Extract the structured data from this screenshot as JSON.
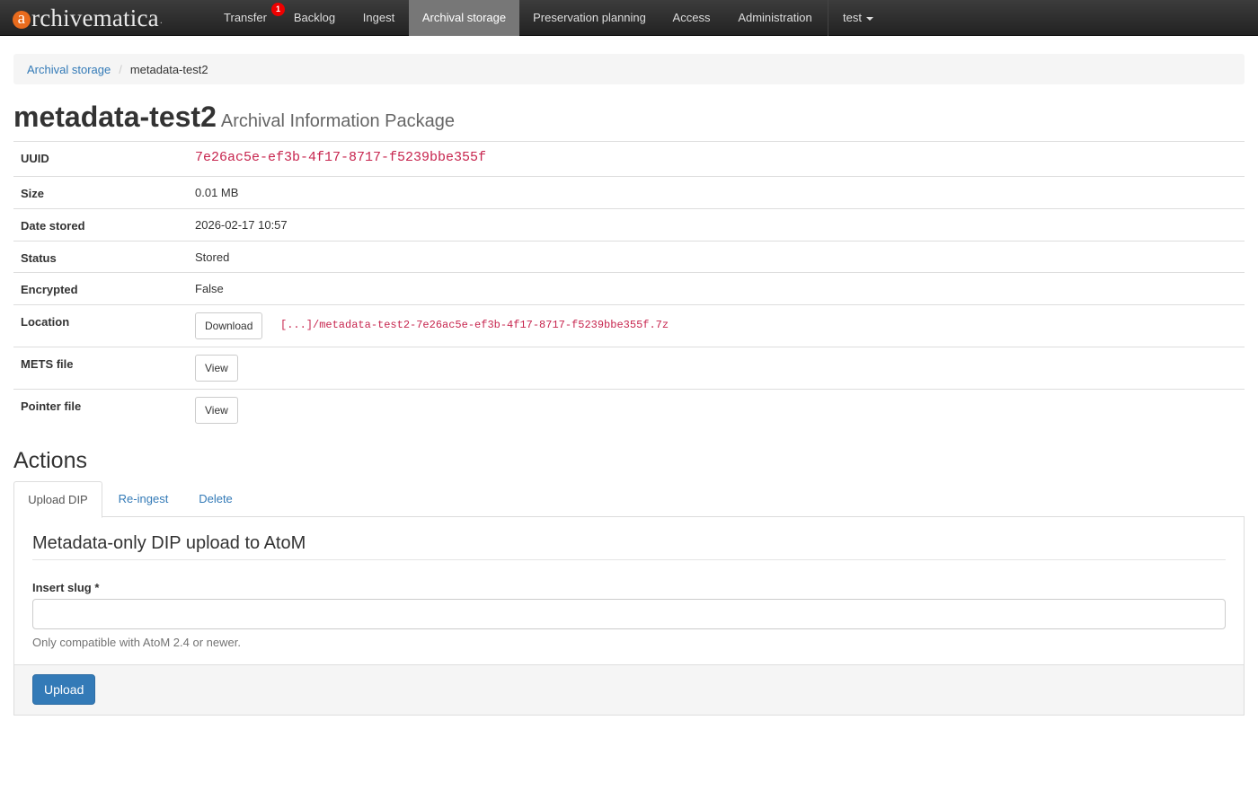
{
  "navbar": {
    "brand": {
      "mark": "a",
      "text": "rchivematica",
      "dot": "."
    },
    "items": [
      {
        "label": "Transfer",
        "badge": "1"
      },
      {
        "label": "Backlog"
      },
      {
        "label": "Ingest"
      },
      {
        "label": "Archival storage"
      },
      {
        "label": "Preservation planning"
      },
      {
        "label": "Access"
      },
      {
        "label": "Administration"
      }
    ],
    "active_item": "Archival storage",
    "user_menu": "test"
  },
  "breadcrumb": {
    "parent": "Archival storage",
    "current": "metadata-test2"
  },
  "page": {
    "title": "metadata-test2",
    "subtitle": "Archival Information Package"
  },
  "info": {
    "uuid_label": "UUID",
    "uuid": "7e26ac5e-ef3b-4f17-8717-f5239bbe355f",
    "size_label": "Size",
    "size": "0.01 MB",
    "date_label": "Date stored",
    "date": "2026-02-17 10:57",
    "status_label": "Status",
    "status": "Stored",
    "encrypted_label": "Encrypted",
    "encrypted": "False",
    "location_label": "Location",
    "download_label": "Download",
    "location_path": "[...]/metadata-test2-7e26ac5e-ef3b-4f17-8717-f5239bbe355f.7z",
    "mets_label": "METS file",
    "mets_view": "View",
    "pointer_label": "Pointer file",
    "pointer_view": "View"
  },
  "actions": {
    "title": "Actions",
    "tabs": [
      "Upload DIP",
      "Re-ingest",
      "Delete"
    ],
    "active_tab": "Upload DIP",
    "panel": {
      "heading": "Metadata-only DIP upload to AtoM",
      "field_label": "Insert slug *",
      "input_value": "",
      "help": "Only compatible with AtoM 2.4 or newer.",
      "submit_label": "Upload"
    }
  },
  "colors": {
    "accent": "#337ab7",
    "code": "#c7254e",
    "brand_orange": "#e86b1d",
    "badge": "#ee0000"
  }
}
